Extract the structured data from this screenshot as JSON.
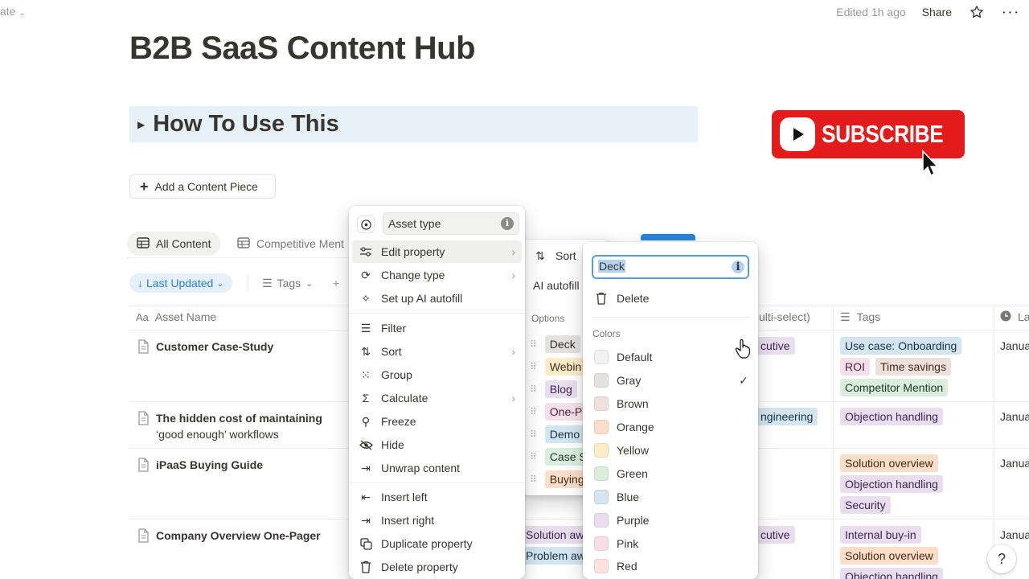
{
  "topbar": {
    "left_text": "ate",
    "edited": "Edited 1h ago",
    "share": "Share"
  },
  "page": {
    "title": "B2B SaaS Content Hub",
    "callout_heading": "How To Use This",
    "subscribe_text": "SUBSCRIBE",
    "add_button": "Add a Content Piece"
  },
  "views": {
    "tabs": [
      "All Content",
      "Competitive Ment"
    ]
  },
  "filters": {
    "last_updated": "Last Updated",
    "tags": "Tags",
    "plus": "+"
  },
  "table": {
    "headers": {
      "asset_name": "Asset Name",
      "multi_select": "ulti-select)",
      "tags": "Tags",
      "last": "La"
    },
    "rows": [
      {
        "title": "Customer Case-Study",
        "col_c": "cutive",
        "tags": [
          "Use case: Onboarding",
          "ROI",
          "Time savings",
          "Competitor Mention"
        ],
        "date": "Janua"
      },
      {
        "title_line1": "The hidden cost of maintaining",
        "title_line2": "‘good enough’ workflows",
        "col_c": "ngineering",
        "tags": [
          "Objection handling"
        ],
        "date": "Janua"
      },
      {
        "title": "iPaaS Buying Guide",
        "tags": [
          "Solution overview",
          "Objection handling",
          "Security"
        ],
        "date": "Janua"
      },
      {
        "title": "Company Overview One-Pager",
        "col_b": [
          "Solution aw",
          "Problem aw"
        ],
        "col_c": "cutive",
        "tags": [
          "Internal buy-in",
          "Solution overview",
          "Objection handling"
        ],
        "date": "Janua"
      }
    ]
  },
  "property_menu": {
    "name_value": "Asset type",
    "items": [
      {
        "label": "Edit property",
        "icon": "sliders-icon",
        "submenu": true
      },
      {
        "label": "Change type",
        "icon": "refresh-icon",
        "submenu": true
      },
      {
        "label": "Set up AI autofill",
        "icon": "sparkle-icon",
        "submenu": false
      },
      {
        "label": "Filter",
        "icon": "filter-icon",
        "submenu": false
      },
      {
        "label": "Sort",
        "icon": "sort-icon",
        "submenu": true
      },
      {
        "label": "Group",
        "icon": "grid-icon",
        "submenu": false
      },
      {
        "label": "Calculate",
        "icon": "sigma-icon",
        "submenu": true
      },
      {
        "label": "Freeze",
        "icon": "pin-icon",
        "submenu": false
      },
      {
        "label": "Hide",
        "icon": "eye-off-icon",
        "submenu": false
      },
      {
        "label": "Unwrap content",
        "icon": "unwrap-icon",
        "submenu": false
      },
      {
        "label": "Insert left",
        "icon": "insert-left-icon",
        "submenu": false
      },
      {
        "label": "Insert right",
        "icon": "insert-right-icon",
        "submenu": false
      },
      {
        "label": "Duplicate property",
        "icon": "duplicate-icon",
        "submenu": false
      },
      {
        "label": "Delete property",
        "icon": "trash-icon",
        "submenu": false
      }
    ]
  },
  "edit_menu": {
    "sort": "Sort",
    "ai_autofill": "AI autofill",
    "options_label": "Options",
    "options": [
      "Deck",
      "Webin",
      "Blog",
      "One-P",
      "Demo",
      "Case S",
      "Buying"
    ]
  },
  "option_menu": {
    "name_value": "Deck",
    "delete": "Delete",
    "colors_label": "Colors",
    "colors": [
      {
        "label": "Default",
        "hex": "#f1f1ef"
      },
      {
        "label": "Gray",
        "hex": "#e3e2e0",
        "selected": true
      },
      {
        "label": "Brown",
        "hex": "#eee0da"
      },
      {
        "label": "Orange",
        "hex": "#fadec9"
      },
      {
        "label": "Yellow",
        "hex": "#fdecc8"
      },
      {
        "label": "Green",
        "hex": "#dbeddb"
      },
      {
        "label": "Blue",
        "hex": "#d3e5ef"
      },
      {
        "label": "Purple",
        "hex": "#e8deee"
      },
      {
        "label": "Pink",
        "hex": "#f5e0e9"
      },
      {
        "label": "Red",
        "hex": "#ffe2dd"
      }
    ]
  },
  "colors": {
    "accent": "#2383e2",
    "subscribe_red": "#e31b1b",
    "callout_bg": "#e6f1f7"
  }
}
